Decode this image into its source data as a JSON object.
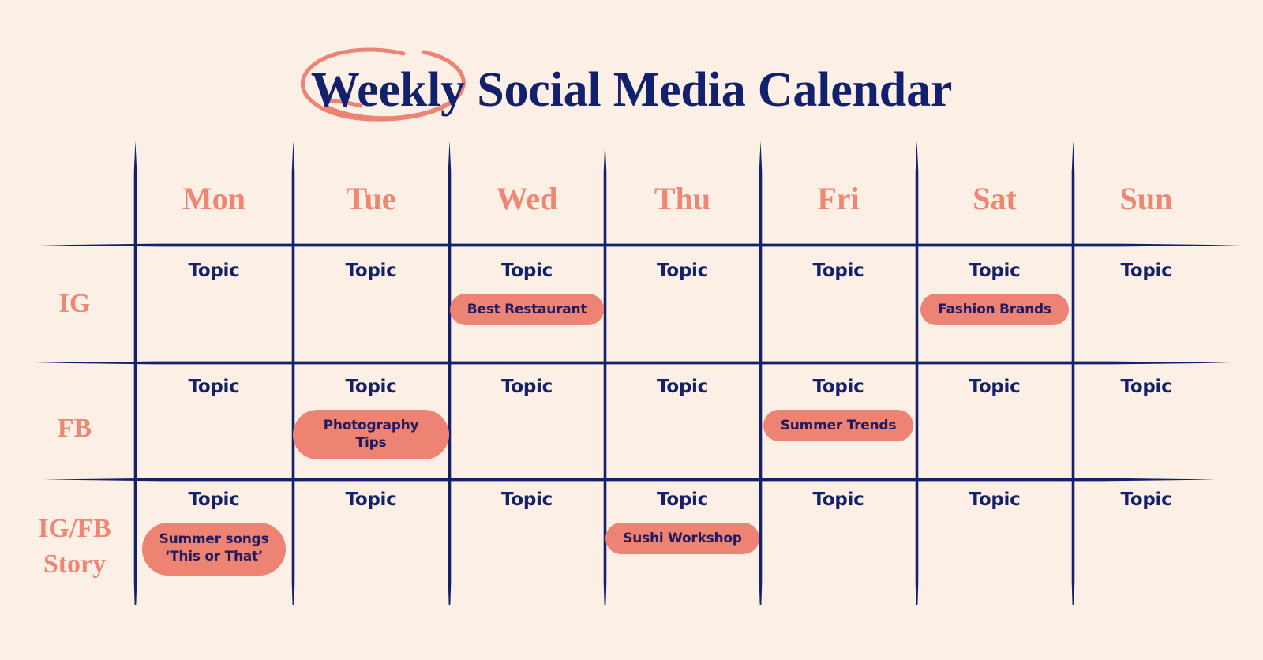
{
  "page": {
    "title_part_circled": "Weekly",
    "title_rest": " Social Media Calendar",
    "title_full": "Weekly Social Media Calendar"
  },
  "colors": {
    "background": "#fcf0e6",
    "navy": "#13206b",
    "coral": "#ed8473",
    "pill_text": "#241a5e"
  },
  "calendar": {
    "days": [
      {
        "label": "Mon"
      },
      {
        "label": "Tue"
      },
      {
        "label": "Wed"
      },
      {
        "label": "Thu"
      },
      {
        "label": "Fri"
      },
      {
        "label": "Sat"
      },
      {
        "label": "Sun"
      }
    ],
    "rows": [
      {
        "label": "IG",
        "cells": [
          {
            "topic": "Topic",
            "tag": ""
          },
          {
            "topic": "Topic",
            "tag": ""
          },
          {
            "topic": "Topic",
            "tag": "Best Restaurant"
          },
          {
            "topic": "Topic",
            "tag": ""
          },
          {
            "topic": "Topic",
            "tag": ""
          },
          {
            "topic": "Topic",
            "tag": "Fashion Brands"
          },
          {
            "topic": "Topic",
            "tag": ""
          }
        ]
      },
      {
        "label": "FB",
        "cells": [
          {
            "topic": "Topic",
            "tag": ""
          },
          {
            "topic": "Topic",
            "tag": "Photography Tips"
          },
          {
            "topic": "Topic",
            "tag": ""
          },
          {
            "topic": "Topic",
            "tag": ""
          },
          {
            "topic": "Topic",
            "tag": "Summer Trends"
          },
          {
            "topic": "Topic",
            "tag": ""
          },
          {
            "topic": "Topic",
            "tag": ""
          }
        ]
      },
      {
        "label": "IG/FB\nStory",
        "cells": [
          {
            "topic": "Topic",
            "tag": "Summer songs\n‘This or That’"
          },
          {
            "topic": "Topic",
            "tag": ""
          },
          {
            "topic": "Topic",
            "tag": ""
          },
          {
            "topic": "Topic",
            "tag": "Sushi Workshop"
          },
          {
            "topic": "Topic",
            "tag": ""
          },
          {
            "topic": "Topic",
            "tag": ""
          },
          {
            "topic": "Topic",
            "tag": ""
          }
        ]
      }
    ]
  }
}
